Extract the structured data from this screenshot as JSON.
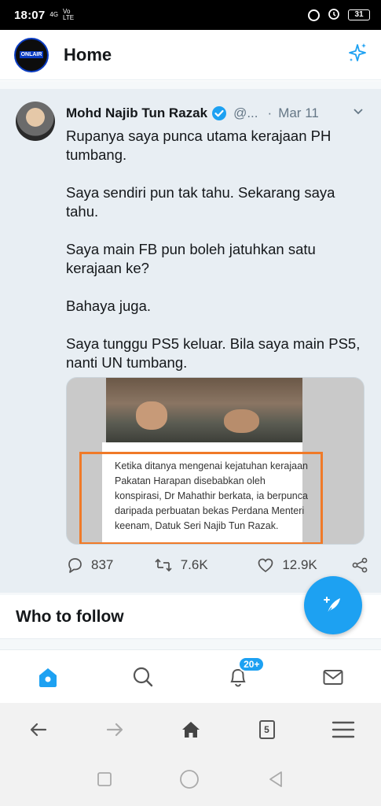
{
  "status_bar": {
    "time": "18:07",
    "network_top": "4G",
    "network_vo": "Vo",
    "network_lte": "LTE",
    "battery": "31"
  },
  "header": {
    "title": "Home",
    "logo_text": "ONLAIR"
  },
  "tweet": {
    "author_name": "Mohd Najib Tun Razak",
    "handle": "@...",
    "separator": "·",
    "date": "Mar 11",
    "paragraphs": [
      "Rupanya saya punca utama kerajaan PH tumbang.",
      "Saya sendiri pun tak tahu. Sekarang saya tahu.",
      "Saya main FB pun boleh jatuhkan satu kerajaan ke?",
      "Bahaya juga.",
      "Saya tunggu PS5 keluar. Bila saya main PS5, nanti UN tumbang."
    ],
    "media_caption": "Ketika ditanya mengenai kejatuhan kerajaan Pakatan Harapan disebabkan oleh konspirasi, Dr Mahathir berkata, ia berpunca daripada perbuatan bekas Perdana Menteri keenam, Datuk Seri Najib Tun Razak.",
    "replies": "837",
    "retweets": "7.6K",
    "likes": "12.9K"
  },
  "who_to_follow": {
    "title": "Who to follow"
  },
  "tabbar": {
    "notification_badge": "20+"
  },
  "browser": {
    "tab_count": "5"
  },
  "colors": {
    "accent": "#1da1f2",
    "highlight_box": "#f07a28"
  }
}
